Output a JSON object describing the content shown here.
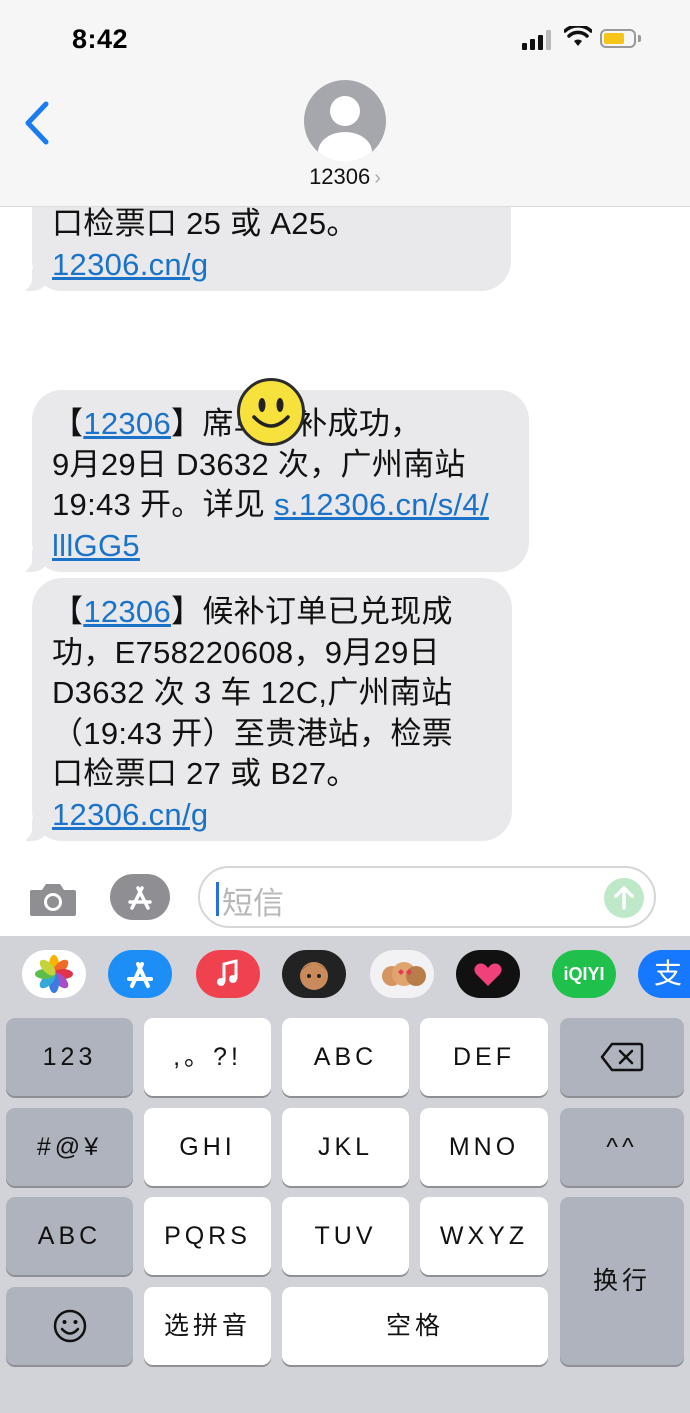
{
  "status": {
    "time": "8:42"
  },
  "header": {
    "contact": "12306",
    "chevron": "›"
  },
  "messages": [
    {
      "line1": "口检票口 25 或 A25。",
      "link": "12306.cn/g"
    },
    {
      "bracket_open": "【",
      "sender": "12306",
      "bracket_close": "】",
      "line1_rest": "席单候补成功，",
      "line2": "9月29日 D3632 次，广州南站",
      "line3_pre": "19:43 开。详见 ",
      "link_part1": "s.12306.cn/s/4/",
      "link_part2": "lllGG5"
    },
    {
      "bracket_open": "【",
      "sender": "12306",
      "bracket_close": "】",
      "line1_rest": "候补订单已兑现成",
      "line2": "功，E758220608，9月29日",
      "line3": "D3632 次 3 车 12C,广州南站",
      "line4": "（19:43 开）至贵港站，检票",
      "line5": "口检票口 27 或 B27。",
      "link": "12306.cn/g"
    }
  ],
  "input": {
    "placeholder": "短信"
  },
  "app_strip": [
    "photos-icon",
    "app-store-icon",
    "music-icon",
    "memoji-icon",
    "memoji-stickers-icon",
    "digital-touch-icon",
    "iqiyi-icon",
    "alipay-icon"
  ],
  "app_strip_labels": {
    "iqiyi": "iQIYI",
    "alipay": "支"
  },
  "keyboard": {
    "row1": {
      "left": "123",
      "k1": ",。?!",
      "k2": "ABC",
      "k3": "DEF"
    },
    "row2": {
      "left": "#@¥",
      "k1": "GHI",
      "k2": "JKL",
      "k3": "MNO",
      "right": "^^"
    },
    "row3": {
      "left": "ABC",
      "k1": "PQRS",
      "k2": "TUV",
      "k3": "WXYZ",
      "right": "换行"
    },
    "row4": {
      "k1": "选拼音",
      "space": "空格"
    }
  },
  "colors": {
    "link": "#1a73c9",
    "bubble": "#e9e9eb",
    "send": "#bfe8c9"
  }
}
